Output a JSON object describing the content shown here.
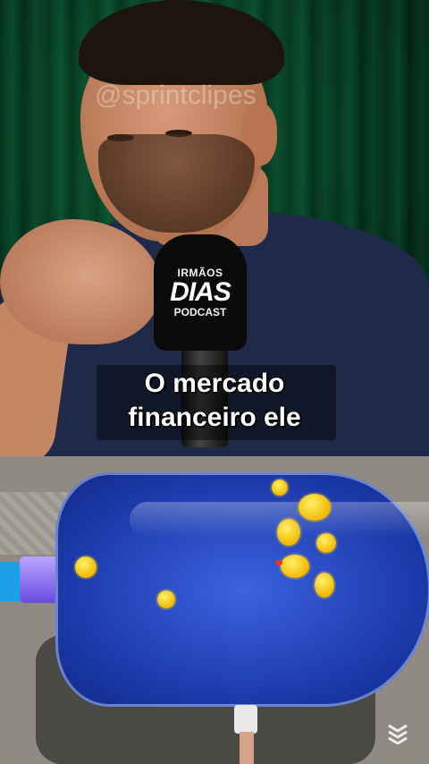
{
  "watermark": "@sprintclipes",
  "microphone_brand": {
    "line1": "IRMÃOS",
    "line2": "DIAS",
    "line3": "PODCAST"
  },
  "caption": {
    "line1": "O mercado",
    "line2": "financeiro ele"
  },
  "colors": {
    "curtain": "#0b5a36",
    "shirt": "#1f2a4a",
    "tank_blue": "#2a4fd0",
    "duck_yellow": "#f4c400"
  },
  "icons": {
    "corner_logo": "app-logo-icon"
  }
}
